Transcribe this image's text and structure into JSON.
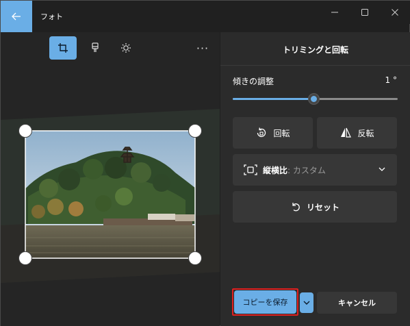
{
  "window": {
    "title": "フォト",
    "controls": [
      "minimize-icon",
      "maximize-icon",
      "close-icon"
    ]
  },
  "toolbar": {
    "tools": [
      {
        "name": "crop-icon",
        "active": true
      },
      {
        "name": "brush-icon",
        "active": false
      },
      {
        "name": "brightness-icon",
        "active": false
      }
    ],
    "more_label": "···"
  },
  "panel": {
    "title": "トリミングと回転",
    "tilt_label": "傾きの調整",
    "tilt_value": "1 °",
    "tilt_fraction": 0.49,
    "rotate_label": "回転",
    "flip_label": "反転",
    "aspect_label": "縦横比",
    "aspect_value": " : カスタム",
    "reset_label": "リセット"
  },
  "footer": {
    "save_label": "コピーを保存",
    "cancel_label": "キャンセル"
  },
  "colors": {
    "accent": "#6aaee6",
    "highlight": "#e02020"
  }
}
